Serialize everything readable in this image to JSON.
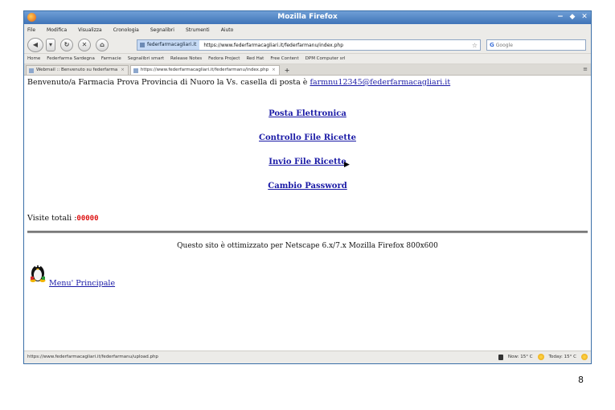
{
  "window": {
    "title": "Mozilla Firefox",
    "minimize": "−",
    "maximize": "◆",
    "close": "✕"
  },
  "menubar": [
    "File",
    "Modifica",
    "Visualizza",
    "Cronologia",
    "Segnalibri",
    "Strumenti",
    "Aiuto"
  ],
  "navbar": {
    "url_site": "federfarmacagliari.it",
    "url": "https://www.federfarmacagliari.it/federfarmanu/index.php",
    "search_engine_icon": "G",
    "search_placeholder": "Google"
  },
  "bookmarks": [
    "Home",
    "Federfarma Sardegna",
    "Farmacie",
    "Segnalibri smart",
    "Release Notes",
    "Fedora Project",
    "Red Hat",
    "Free Content",
    "DPM Computer srl"
  ],
  "tabs": [
    {
      "label": "Webmail :: Benvenuto su federfarma",
      "active": false
    },
    {
      "label": "https://www.federfarmacagliari.it/federfarmanu/index.php",
      "active": true
    }
  ],
  "tab_new": "+",
  "tab_list": "≡",
  "content": {
    "welcome_text": "Benvenuto/a Farmacia Prova Provincia di Nuoro la Vs. casella di posta è ",
    "email": "farmnu12345@federfarmacagliari.it",
    "links": [
      "Posta Elettronica",
      "Controllo File Ricette",
      "Invio File Ricette",
      "Cambio Password"
    ],
    "visite_label": "Visite totali :",
    "visite_count": "00000",
    "optimized_text": "Questo sito è ottimizzato per Netscape 6.x/7.x Mozilla Firefox 800x600",
    "menu_link": "Menu' Principale"
  },
  "statusbar": {
    "url": "https://www.federfarmacagliari.it/federfarmanu/upload.php",
    "weather_now": "Now: 15° C",
    "weather_today": "Today: 15° C"
  },
  "page_number": "8",
  "colors": {
    "link": "#1a1aa6",
    "titlebar": "#3f74b8",
    "counter": "#dd1111"
  }
}
